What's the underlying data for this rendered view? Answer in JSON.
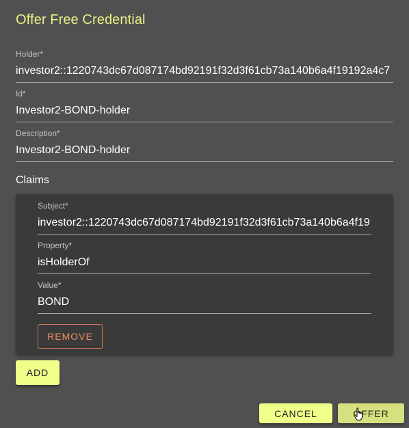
{
  "dialog": {
    "title": "Offer Free Credential",
    "colors": {
      "background": "#505050",
      "title": "#e8f285",
      "card": "#3a3a3a",
      "primary_button": "#efff8a",
      "remove_button": "#ec8f64"
    }
  },
  "fields": {
    "holder": {
      "label": "Holder",
      "required_mark": "*",
      "value": "investor2::1220743dc67d087174bd92191f32d3f61cb73a140b6a4f19192a4c7"
    },
    "id": {
      "label": "Id",
      "required_mark": "*",
      "value": "Investor2-BOND-holder"
    },
    "description": {
      "label": "Description",
      "required_mark": "*",
      "value": "Investor2-BOND-holder"
    }
  },
  "claims": {
    "heading": "Claims",
    "items": [
      {
        "subject": {
          "label": "Subject",
          "required_mark": "*",
          "value": "investor2::1220743dc67d087174bd92191f32d3f61cb73a140b6a4f19"
        },
        "property": {
          "label": "Property",
          "required_mark": "*",
          "value": "isHolderOf"
        },
        "value": {
          "label": "Value",
          "required_mark": "*",
          "value": "BOND"
        },
        "remove_label": "REMOVE"
      }
    ],
    "add_label": "ADD"
  },
  "actions": {
    "cancel_label": "CANCEL",
    "offer_label": "OFFER"
  },
  "icons": {
    "cursor": "hand-pointer-icon"
  }
}
